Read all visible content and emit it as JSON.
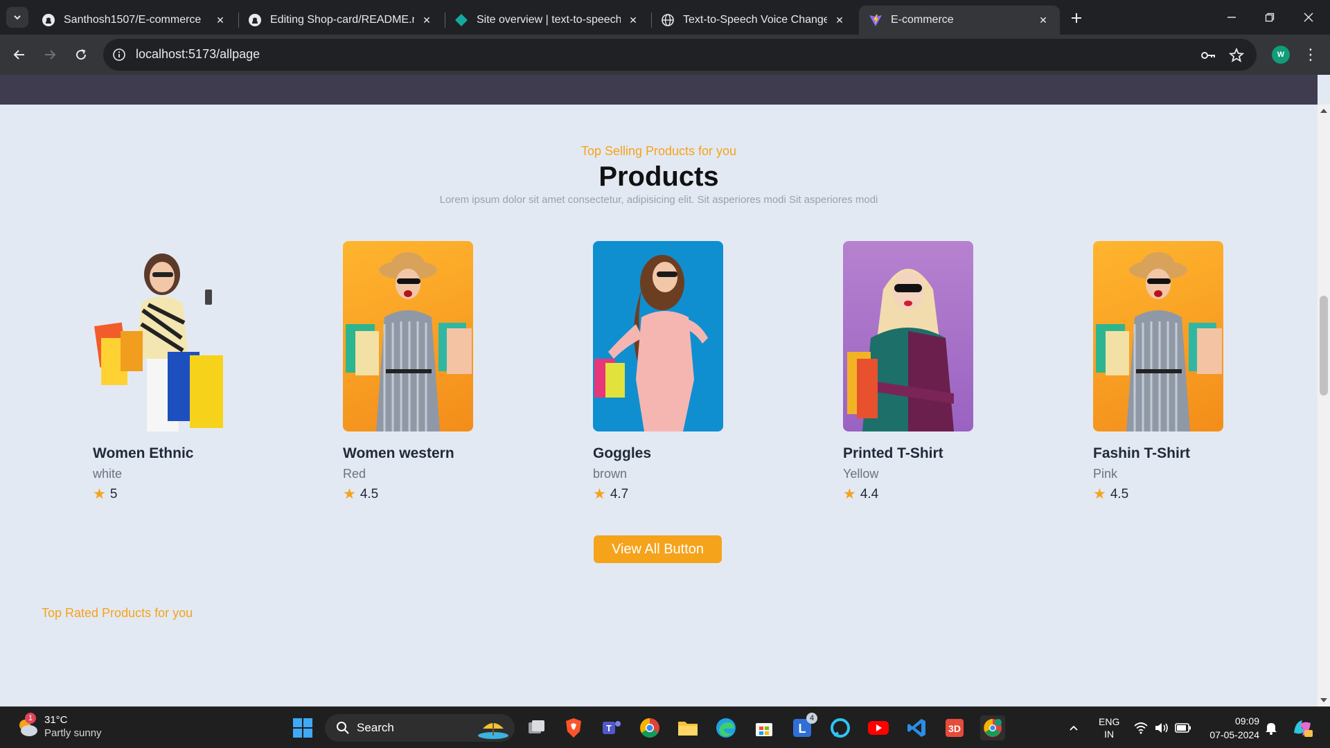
{
  "browser": {
    "tabs": [
      {
        "title": "Santhosh1507/E-commerce",
        "icon": "github-icon"
      },
      {
        "title": "Editing Shop-card/README.md",
        "icon": "github-icon"
      },
      {
        "title": "Site overview | text-to-speech-",
        "icon": "netlify-icon"
      },
      {
        "title": "Text-to-Speech Voice Changer",
        "icon": "globe-icon"
      },
      {
        "title": "E-commerce",
        "icon": "vite-icon"
      }
    ],
    "active_tab": 4,
    "url": "localhost:5173/allpage",
    "profile_initial": "W"
  },
  "page": {
    "eyebrow": "Top Selling Products for you",
    "heading": "Products",
    "subtext": "Lorem ipsum dolor sit amet consectetur, adipisicing elit. Sit asperiores modi Sit asperiores modi",
    "products": [
      {
        "name": "Women Ethnic",
        "color": "white",
        "rating": "5"
      },
      {
        "name": "Women western",
        "color": "Red",
        "rating": "4.5"
      },
      {
        "name": "Goggles",
        "color": "brown",
        "rating": "4.7"
      },
      {
        "name": "Printed T-Shirt",
        "color": "Yellow",
        "rating": "4.4"
      },
      {
        "name": "Fashin T-Shirt",
        "color": "Pink",
        "rating": "4.5"
      }
    ],
    "view_all_label": "View All Button",
    "top_rated_label": "Top Rated Products for you",
    "colors": {
      "accent": "#f5a31a",
      "header": "#403c50",
      "background": "#e3e9f3"
    }
  },
  "taskbar": {
    "weather_temp": "31°C",
    "weather_condition": "Partly sunny",
    "weather_badge": "1",
    "search_label": "Search",
    "lang_top": "ENG",
    "lang_bottom": "IN",
    "time": "09:09",
    "date": "07-05-2024",
    "badge_l": "4"
  }
}
